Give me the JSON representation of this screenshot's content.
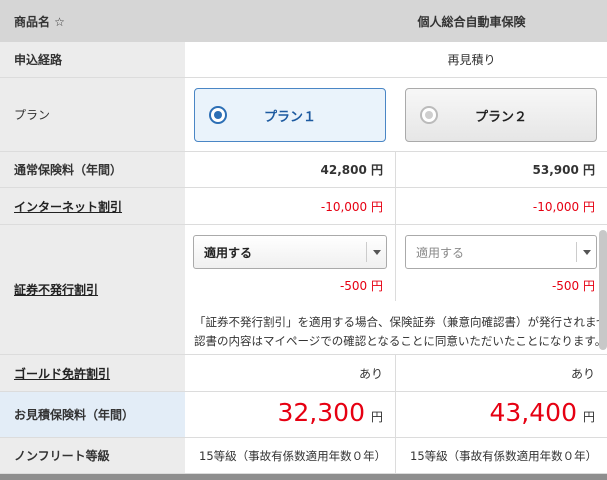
{
  "header": {
    "label": "商品名 ☆",
    "product": "個人総合自動車保険"
  },
  "route": {
    "label": "申込経路",
    "value": "再見積り"
  },
  "plan": {
    "label": "プラン",
    "plans": [
      {
        "label": "プラン１",
        "selected": true
      },
      {
        "label": "プラン２",
        "selected": false
      }
    ]
  },
  "premium": {
    "label": "通常保険料（年間）",
    "values": [
      "42,800 円",
      "53,900 円"
    ]
  },
  "internet": {
    "label": "インターネット割引",
    "values": [
      "-10,000 円",
      "-10,000 円"
    ]
  },
  "paperless": {
    "label": "証券不発行割引",
    "selects": [
      "適用する",
      "適用する"
    ],
    "values": [
      "-500 円",
      "-500 円"
    ],
    "note_line1": "「証券不発行割引」を適用する場合、保険証券（兼意向確認書）が発行されませ",
    "note_line2": "認書の内容はマイページでの確認となることに同意いただいたことになります。"
  },
  "gold": {
    "label": "ゴールド免許割引",
    "values": [
      "あり",
      "あり"
    ]
  },
  "estimate": {
    "label": "お見積保険料（年間）",
    "values": [
      {
        "num": "32,300",
        "unit": "円"
      },
      {
        "num": "43,400",
        "unit": "円"
      }
    ]
  },
  "nonfleet": {
    "label": "ノンフリート等級",
    "values": [
      "15等級（事故有係数適用年数０年）",
      "15等級（事故有係数適用年数０年）"
    ]
  },
  "colors": {
    "accent": "#2d6fb5",
    "discount": "#e60012",
    "label_bg": "#ececec",
    "header_bg": "#d6d6d6"
  }
}
